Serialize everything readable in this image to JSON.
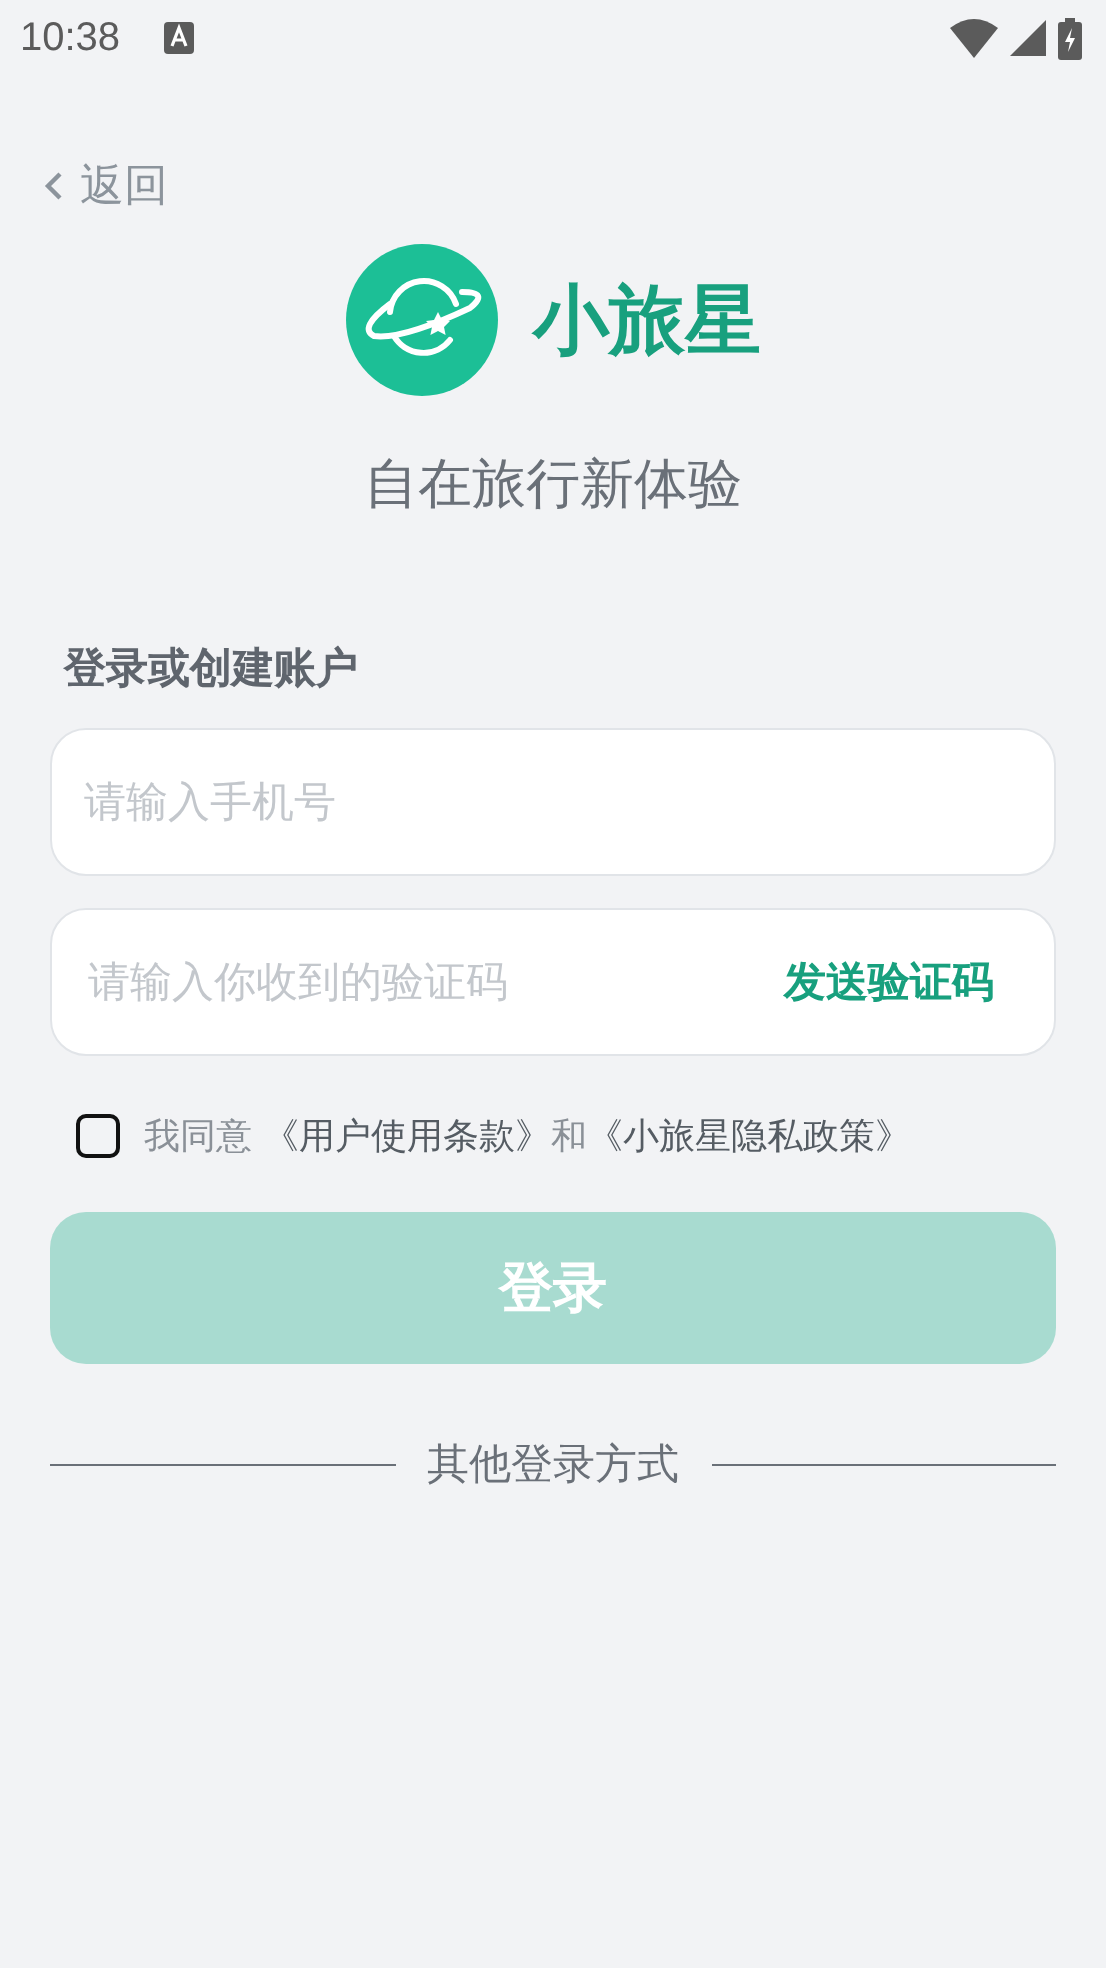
{
  "status_bar": {
    "time": "10:38"
  },
  "back": {
    "label": "返回"
  },
  "brand": {
    "name": "小旅星",
    "slogan": "自在旅行新体验"
  },
  "form": {
    "title": "登录或创建账户",
    "phone": {
      "placeholder": "请输入手机号"
    },
    "code": {
      "placeholder": "请输入你收到的验证码",
      "send_label": "发送验证码"
    },
    "agreement": {
      "checked": false,
      "prefix": "我同意",
      "terms": "《用户使用条款》",
      "joiner": "和",
      "privacy": "《小旅星隐私政策》"
    },
    "login": {
      "label": "登录",
      "disabled": true
    }
  },
  "other": {
    "label": "其他登录方式"
  }
}
